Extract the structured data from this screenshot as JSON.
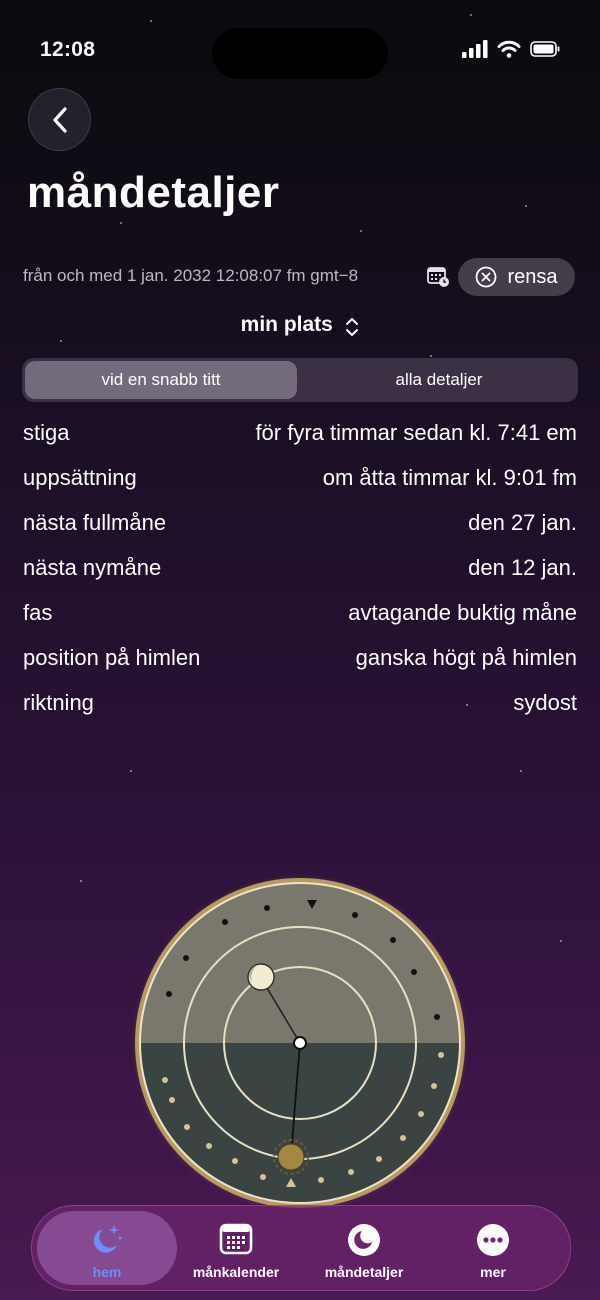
{
  "status_bar": {
    "time": "12:08"
  },
  "header": {
    "title": "måndetaljer"
  },
  "date_row": {
    "text": "från och med 1 jan. 2032 12:08:07 fm gmt−8",
    "clear_label": "rensa"
  },
  "location": {
    "label": "min plats"
  },
  "segmented_control": {
    "options": [
      "vid en snabb titt",
      "alla detaljer"
    ],
    "selected": "vid en snabb titt"
  },
  "details": [
    {
      "label": "stiga",
      "value": "för fyra timmar sedan kl. 7:41 em"
    },
    {
      "label": "uppsättning",
      "value": "om åtta timmar kl. 9:01 fm"
    },
    {
      "label": "nästa fullmåne",
      "value": "den 27 jan."
    },
    {
      "label": "nästa nymåne",
      "value": "den 12 jan."
    },
    {
      "label": "fas",
      "value": "avtagande buktig måne"
    },
    {
      "label": "position på himlen",
      "value": "ganska högt på himlen"
    },
    {
      "label": "riktning",
      "value": "sydost"
    }
  ],
  "tab_bar": {
    "items": [
      {
        "label": "hem",
        "icon": "moon-stars-icon",
        "selected": true
      },
      {
        "label": "månkalender",
        "icon": "calendar-icon",
        "selected": false
      },
      {
        "label": "måndetaljer",
        "icon": "moon-circle-icon",
        "selected": false
      },
      {
        "label": "mer",
        "icon": "more-icon",
        "selected": false
      }
    ]
  },
  "colors": {
    "accent_blue": "#6b8dff",
    "sky_dial": "#7a776c",
    "ground_dial": "#3a4443",
    "dial_rim": "#b79a5e"
  }
}
